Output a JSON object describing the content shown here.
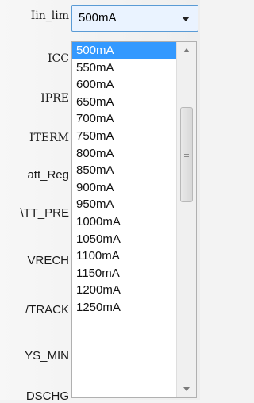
{
  "labels": [
    "Iin_lim",
    "ICC",
    "IPRE",
    "ITERM",
    "att_Reg",
    "\\TT_PRE",
    "VRECH",
    "/TRACK",
    "YS_MIN",
    "DSCHG"
  ],
  "combo": {
    "value": "500mA"
  },
  "dropdown": {
    "options": [
      "500mA",
      "550mA",
      "600mA",
      "650mA",
      "700mA",
      "750mA",
      "800mA",
      "850mA",
      "900mA",
      "950mA",
      "1000mA",
      "1050mA",
      "1100mA",
      "1150mA",
      "1200mA",
      "1250mA"
    ],
    "selected_index": 0
  },
  "icons": {
    "combo_arrow": "chevron-down-icon",
    "scroll_up": "scroll-up-arrow-icon",
    "scroll_down": "scroll-down-arrow-icon"
  }
}
